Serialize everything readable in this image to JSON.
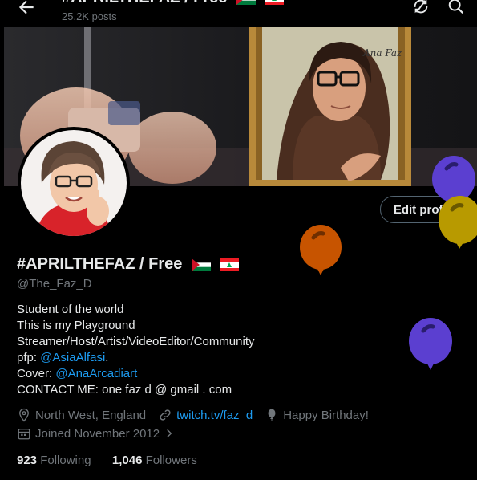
{
  "header": {
    "title": "#APRILTHEFAZ / Free",
    "post_count": "25.2K posts"
  },
  "profile": {
    "display_name": "#APRILTHEFAZ / Free",
    "handle": "@The_Faz_D",
    "edit_button": "Edit profile",
    "bio": {
      "line1": "Student of the world",
      "line2": "This is my Playground",
      "line3": "Streamer/Host/Artist/VideoEditor/Community",
      "pfp_label": "pfp: ",
      "pfp_mention": "@AsiaAlfasi",
      "pfp_end": ".",
      "cover_label": "Cover: ",
      "cover_mention": "@AnaArcadiart",
      "contact": "CONTACT ME: one faz d @ gmail . com"
    },
    "location": "North West, England",
    "website": "twitch.tv/faz_d",
    "birthday": "Happy Birthday!",
    "joined": "Joined November 2012",
    "following_count": "923",
    "following_label": "Following",
    "followers_count": "1,046",
    "followers_label": "Followers"
  },
  "banner_signature": "Ana Faz",
  "icons": {
    "back": "arrow-left-icon",
    "refresh": "refresh-icon",
    "search": "search-icon",
    "location": "location-pin-icon",
    "link": "link-icon",
    "birthday": "balloon-icon",
    "calendar": "calendar-icon",
    "chevron": "chevron-right-icon"
  },
  "colors": {
    "link": "#1d9bf0",
    "muted": "#71767b",
    "balloon_purple": "#5b3fd0",
    "balloon_orange": "#c75400",
    "balloon_gold": "#b89a00"
  }
}
